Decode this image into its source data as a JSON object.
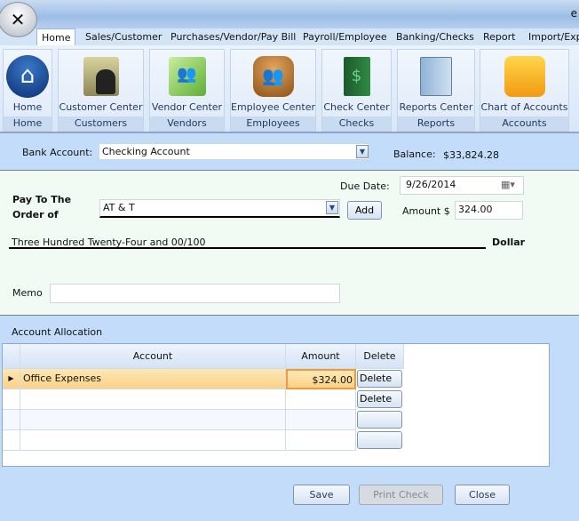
{
  "window": {
    "title_fragment": "e"
  },
  "tabs": [
    {
      "label": "Home",
      "active": true
    },
    {
      "label": "Sales/Customer"
    },
    {
      "label": "Purchases/Vendor/Pay Bill"
    },
    {
      "label": "Payroll/Employee"
    },
    {
      "label": "Banking/Checks"
    },
    {
      "label": "Report"
    },
    {
      "label": "Import/Exp"
    }
  ],
  "ribbon": [
    {
      "label": "Home",
      "group": "Home",
      "icon": "home-icon"
    },
    {
      "label": "Customer Center",
      "group": "Customers",
      "icon": "customer-folder-icon"
    },
    {
      "label": "Vendor Center",
      "group": "Vendors",
      "icon": "vendor-book-icon"
    },
    {
      "label": "Employee Center",
      "group": "Employees",
      "icon": "employees-icon"
    },
    {
      "label": "Check Center",
      "group": "Checks",
      "icon": "checkbook-icon"
    },
    {
      "label": "Reports Center",
      "group": "Reports",
      "icon": "reports-binder-icon"
    },
    {
      "label": "Chart of Accounts",
      "group": "Accounts",
      "icon": "accounts-folder-icon"
    }
  ],
  "form": {
    "bank_account_label": "Bank Account:",
    "bank_account_value": "Checking Account",
    "balance_label": "Balance:",
    "balance_value": "$33,824.28",
    "due_date_label": "Due Date:",
    "due_date_value": "9/26/2014",
    "pay_to_label_1": "Pay To The",
    "pay_to_label_2": "Order of",
    "payee_value": "AT & T",
    "add_label": "Add",
    "amount_label": "Amount $",
    "amount_value": "324.00",
    "amount_words": "Three Hundred Twenty-Four and 00/100",
    "dollar_label": "Dollar",
    "memo_label": "Memo",
    "memo_value": ""
  },
  "allocation": {
    "title": "Account Allocation",
    "columns": [
      "Account",
      "Amount",
      "Delete"
    ],
    "rows": [
      {
        "account": "Office Expenses",
        "amount": "$324.00",
        "delete": "Delete",
        "selected": true
      },
      {
        "account": "",
        "amount": "",
        "delete": "Delete"
      },
      {
        "account": "",
        "amount": "",
        "delete": ""
      },
      {
        "account": "",
        "amount": "",
        "delete": ""
      }
    ]
  },
  "buttons": {
    "save": "Save",
    "print": "Print Check",
    "close": "Close"
  },
  "colors": {
    "selected_row": "#fbd287",
    "panel_blue": "#c3dcf9"
  }
}
